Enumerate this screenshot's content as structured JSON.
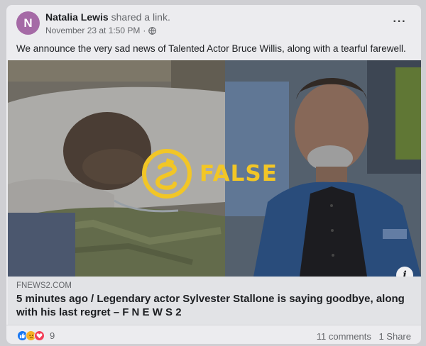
{
  "post": {
    "author_initial": "N",
    "author_name": "Natalia Lewis",
    "action": "shared a link.",
    "timestamp": "November 23 at 1:50 PM",
    "separator": "·",
    "audience_icon": "globe-icon",
    "more_icon": "more-options-icon",
    "more_glyph": "···",
    "text": "We announce the very sad news of Talented Actor Bruce Willis, along with a tearful farewell."
  },
  "media": {
    "verdict_label": "FALSE",
    "verdict_color": "#f2c626",
    "info_glyph": "i"
  },
  "link": {
    "domain": "FNEWS2.COM",
    "headline": "5 minutes ago / Legendary actor Sylvester Stallone is saying goodbye, along with his last regret – F N E W S 2"
  },
  "footer": {
    "reaction_icons": [
      "like-icon",
      "sad-icon",
      "love-icon"
    ],
    "reaction_count": "9",
    "comments": "11 comments",
    "shares": "1 Share"
  },
  "colors": {
    "avatar": "#a56aa6",
    "like": "#1877f2",
    "sad": "#f7b125",
    "love": "#f33e58"
  }
}
